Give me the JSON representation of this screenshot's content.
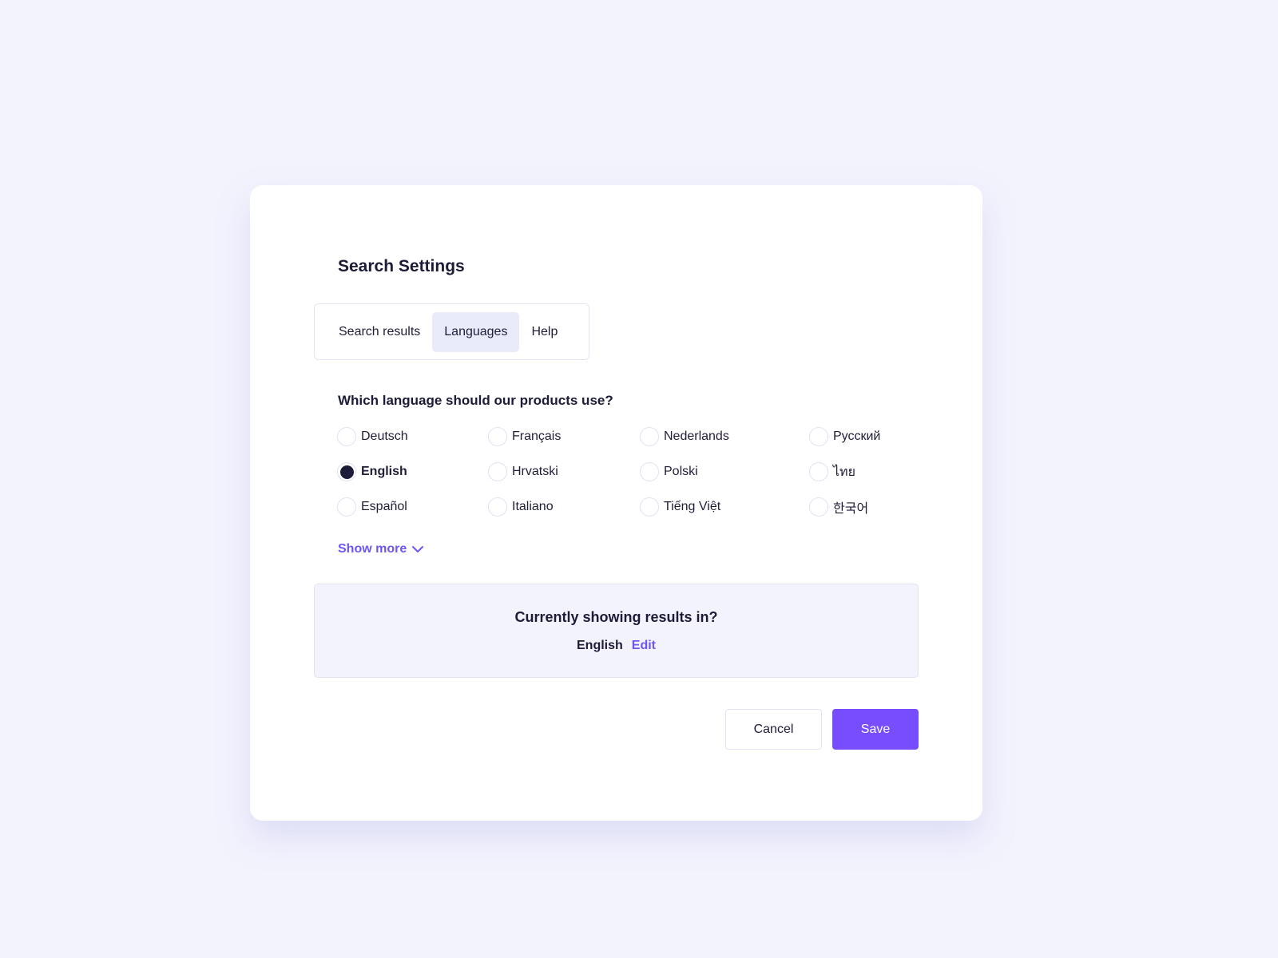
{
  "dialog": {
    "title": "Search Settings"
  },
  "tabs": [
    {
      "label": "Search results",
      "active": false
    },
    {
      "label": "Languages",
      "active": true
    },
    {
      "label": "Help",
      "active": false
    }
  ],
  "languages": {
    "question": "Which language should our products use?",
    "selected": "English",
    "options": [
      {
        "label": "Deutsch",
        "checked": false
      },
      {
        "label": "English",
        "checked": true
      },
      {
        "label": "Español",
        "checked": false
      },
      {
        "label": "Français",
        "checked": false
      },
      {
        "label": "Hrvatski",
        "checked": false
      },
      {
        "label": "Italiano",
        "checked": false
      },
      {
        "label": "Nederlands",
        "checked": false
      },
      {
        "label": "Polski",
        "checked": false
      },
      {
        "label": "Tiếng Việt",
        "checked": false
      },
      {
        "label": "Русский",
        "checked": false
      },
      {
        "label": "ไทย",
        "checked": false
      },
      {
        "label": "한국어",
        "checked": false
      }
    ],
    "show_more_label": "Show more",
    "show_more_icon": "chevron-down-icon"
  },
  "current": {
    "heading": "Currently showing results in?",
    "language": "English",
    "edit_label": "Edit"
  },
  "actions": {
    "cancel_label": "Cancel",
    "save_label": "Save"
  },
  "colors": {
    "accent": "#774dfd",
    "link": "#6c57f5",
    "background": "#f3f3fd",
    "active_tab": "#e9eafa",
    "text": "#1c1b38"
  }
}
